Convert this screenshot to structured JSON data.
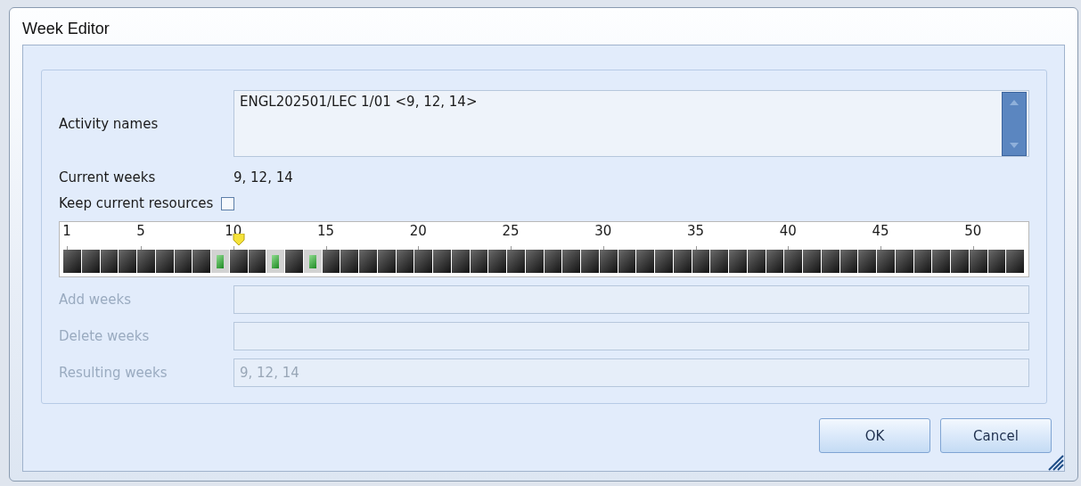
{
  "window": {
    "title": "Week Editor"
  },
  "activity_names": {
    "label": "Activity names",
    "value": "ENGL202501/LEC 1/01 <9, 12, 14>"
  },
  "current_weeks": {
    "label": "Current weeks",
    "value": "9, 12, 14"
  },
  "keep_current_resources": {
    "label": "Keep current resources",
    "checked": false
  },
  "weeks": [
    {
      "label": "1",
      "selected": false,
      "current": false
    },
    {
      "selected": false,
      "current": false
    },
    {
      "selected": false,
      "current": false
    },
    {
      "selected": false,
      "current": false
    },
    {
      "label": "5",
      "selected": false,
      "current": false
    },
    {
      "selected": false,
      "current": false
    },
    {
      "selected": false,
      "current": false
    },
    {
      "selected": false,
      "current": false
    },
    {
      "selected": true,
      "current": false
    },
    {
      "label": "10",
      "selected": false,
      "current": true
    },
    {
      "selected": false,
      "current": false
    },
    {
      "selected": true,
      "current": false
    },
    {
      "selected": false,
      "current": false
    },
    {
      "selected": true,
      "current": false
    },
    {
      "label": "15",
      "selected": false,
      "current": false
    },
    {
      "selected": false,
      "current": false
    },
    {
      "selected": false,
      "current": false
    },
    {
      "selected": false,
      "current": false
    },
    {
      "selected": false,
      "current": false
    },
    {
      "label": "20",
      "selected": false,
      "current": false
    },
    {
      "selected": false,
      "current": false
    },
    {
      "selected": false,
      "current": false
    },
    {
      "selected": false,
      "current": false
    },
    {
      "selected": false,
      "current": false
    },
    {
      "label": "25",
      "selected": false,
      "current": false
    },
    {
      "selected": false,
      "current": false
    },
    {
      "selected": false,
      "current": false
    },
    {
      "selected": false,
      "current": false
    },
    {
      "selected": false,
      "current": false
    },
    {
      "label": "30",
      "selected": false,
      "current": false
    },
    {
      "selected": false,
      "current": false
    },
    {
      "selected": false,
      "current": false
    },
    {
      "selected": false,
      "current": false
    },
    {
      "selected": false,
      "current": false
    },
    {
      "label": "35",
      "selected": false,
      "current": false
    },
    {
      "selected": false,
      "current": false
    },
    {
      "selected": false,
      "current": false
    },
    {
      "selected": false,
      "current": false
    },
    {
      "selected": false,
      "current": false
    },
    {
      "label": "40",
      "selected": false,
      "current": false
    },
    {
      "selected": false,
      "current": false
    },
    {
      "selected": false,
      "current": false
    },
    {
      "selected": false,
      "current": false
    },
    {
      "selected": false,
      "current": false
    },
    {
      "label": "45",
      "selected": false,
      "current": false
    },
    {
      "selected": false,
      "current": false
    },
    {
      "selected": false,
      "current": false
    },
    {
      "selected": false,
      "current": false
    },
    {
      "selected": false,
      "current": false
    },
    {
      "label": "50",
      "selected": false,
      "current": false
    },
    {
      "selected": false,
      "current": false
    },
    {
      "selected": false,
      "current": false
    }
  ],
  "fields": [
    {
      "label": "Add weeks",
      "disabled": true
    },
    {
      "label": "Delete weeks",
      "disabled": true
    },
    {
      "label": "Resulting weeks",
      "value": "9, 12, 14",
      "disabled": true
    }
  ],
  "buttons": [
    "OK",
    "Cancel"
  ]
}
